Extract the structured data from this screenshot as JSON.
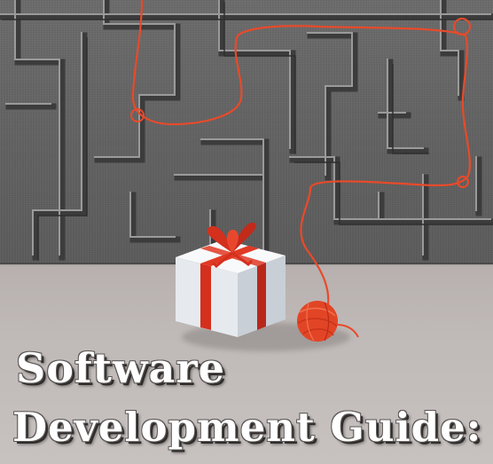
{
  "cover": {
    "title_line_1": "Software",
    "title_line_2": "Development Guide:"
  },
  "icons": {
    "maze": "maze-icon",
    "gift": "gift-box-icon",
    "yarn": "yarn-ball-icon"
  },
  "colors": {
    "maze_wall": "#666666",
    "floor": "#bdb7b5",
    "yarn": "#e84a2a",
    "ribbon": "#d4301e",
    "gift_box": "#eef1f4",
    "title_text": "#ffffff"
  }
}
